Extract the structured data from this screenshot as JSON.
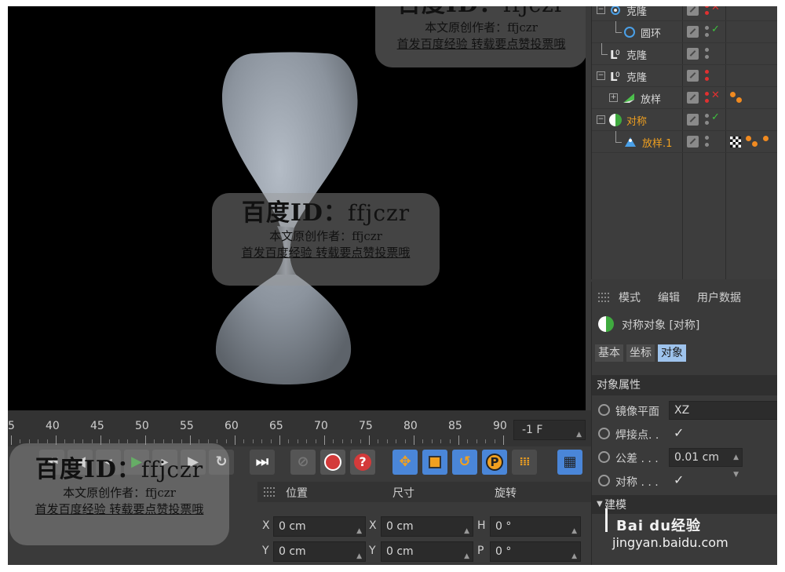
{
  "object_manager": {
    "rows": [
      {
        "name": "克隆",
        "icon": "cloner-icon",
        "status": "x"
      },
      {
        "name": "圆环",
        "icon": "circle-icon",
        "status": "ok"
      },
      {
        "name": "克隆",
        "icon": "cloner-icon",
        "status": "none"
      },
      {
        "name": "克隆",
        "icon": "cloner-icon",
        "status": "none"
      },
      {
        "name": "放样",
        "icon": "loft-icon",
        "status": "x"
      },
      {
        "name": "对称",
        "icon": "symmetry-icon",
        "status": "ok"
      },
      {
        "name": "放样.1",
        "icon": "loft-icon",
        "status": "none"
      }
    ]
  },
  "attributes": {
    "menu": [
      "模式",
      "编辑",
      "用户数据"
    ],
    "object_title": "对称对象 [对称]",
    "tabs": [
      "基本",
      "坐标",
      "对象"
    ],
    "active_tab": "对象",
    "section_title": "对象属性",
    "mirror_plane_label": "镜像平面",
    "mirror_plane_value": "XZ",
    "weld_label": "焊接点. .",
    "tolerance_label": "公差 . . .",
    "tolerance_value": "0.01 cm",
    "symmetry_label": "对称 . . .",
    "build_section": "建模",
    "check_glyph": "✓"
  },
  "timeline": {
    "ticks": [
      "5",
      "40",
      "45",
      "50",
      "55",
      "60",
      "65",
      "70",
      "75",
      "80",
      "85",
      "90"
    ],
    "frame_value": "-1 F"
  },
  "coords": {
    "headers": [
      "位置",
      "尺寸",
      "旋转"
    ],
    "rows": [
      {
        "pos_axis": "X",
        "pos": "0 cm",
        "size_axis": "X",
        "size": "0 cm",
        "rot_axis": "H",
        "rot": "0 °"
      },
      {
        "pos_axis": "Y",
        "pos": "0 cm",
        "size_axis": "Y",
        "size": "0 cm",
        "rot_axis": "P",
        "rot": "0 °"
      }
    ]
  },
  "watermark": {
    "id_prefix": "百度ID：",
    "id_value": "ffjczr",
    "author_line": "本文原创作者：ffjczr",
    "notice_line": "首发百度经验 转载要点赞投票哦"
  },
  "site": {
    "brand": "Bai du经验",
    "domain": "jingyan.baidu.com"
  },
  "colors": {
    "accent_blue": "#4a86d8",
    "active_tab": "#9ec3ec",
    "highlight": "#f0a020",
    "error_red": "#e03030",
    "ok_green": "#3ec03e"
  }
}
